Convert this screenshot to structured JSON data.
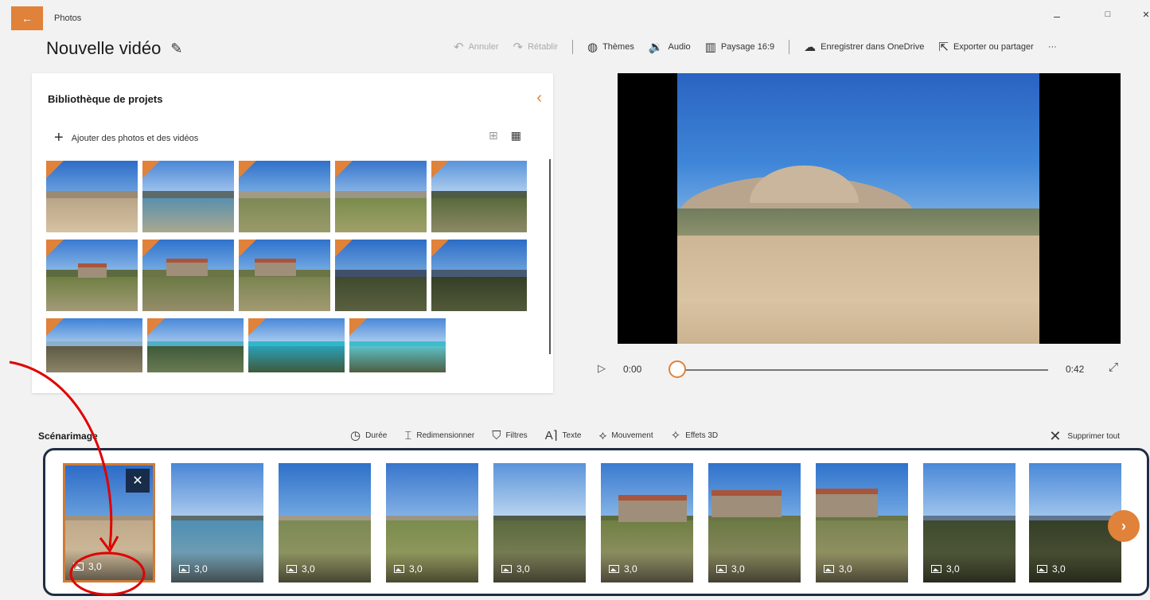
{
  "app": {
    "title": "Photos",
    "back_icon": "back-arrow-icon",
    "accent": "#e0823a"
  },
  "window_controls": {
    "minimize": "–",
    "maximize": "□",
    "close": "✕"
  },
  "header": {
    "video_title": "Nouvelle vidéo",
    "edit_icon": "pencil-icon"
  },
  "toolbar": {
    "undo": "Annuler",
    "redo": "Rétablir",
    "themes": "Thèmes",
    "audio": "Audio",
    "aspect": "Paysage 16:9",
    "save_onedrive": "Enregistrer dans OneDrive",
    "export": "Exporter ou partager",
    "more": "···"
  },
  "library": {
    "title": "Bibliothèque de projets",
    "add_label": "Ajouter des photos et des vidéos",
    "view_mode": "large-grid"
  },
  "player": {
    "current_time": "0:00",
    "end_time": "0:42",
    "progress": 0
  },
  "storyboard": {
    "title": "Scénarimage",
    "tools": [
      "Durée",
      "Redimensionner",
      "Filtres",
      "Texte",
      "Mouvement",
      "Effets 3D"
    ],
    "delete_all": "Supprimer tout",
    "clips": [
      {
        "duration": "3,0",
        "selected": true
      },
      {
        "duration": "3,0"
      },
      {
        "duration": "3,0"
      },
      {
        "duration": "3,0"
      },
      {
        "duration": "3,0"
      },
      {
        "duration": "3,0"
      },
      {
        "duration": "3,0"
      },
      {
        "duration": "3,0"
      },
      {
        "duration": "3,0"
      },
      {
        "duration": "3,0"
      }
    ]
  },
  "annotations": {
    "arrow_color": "#e00000",
    "frame_color": "#1f2d44"
  }
}
